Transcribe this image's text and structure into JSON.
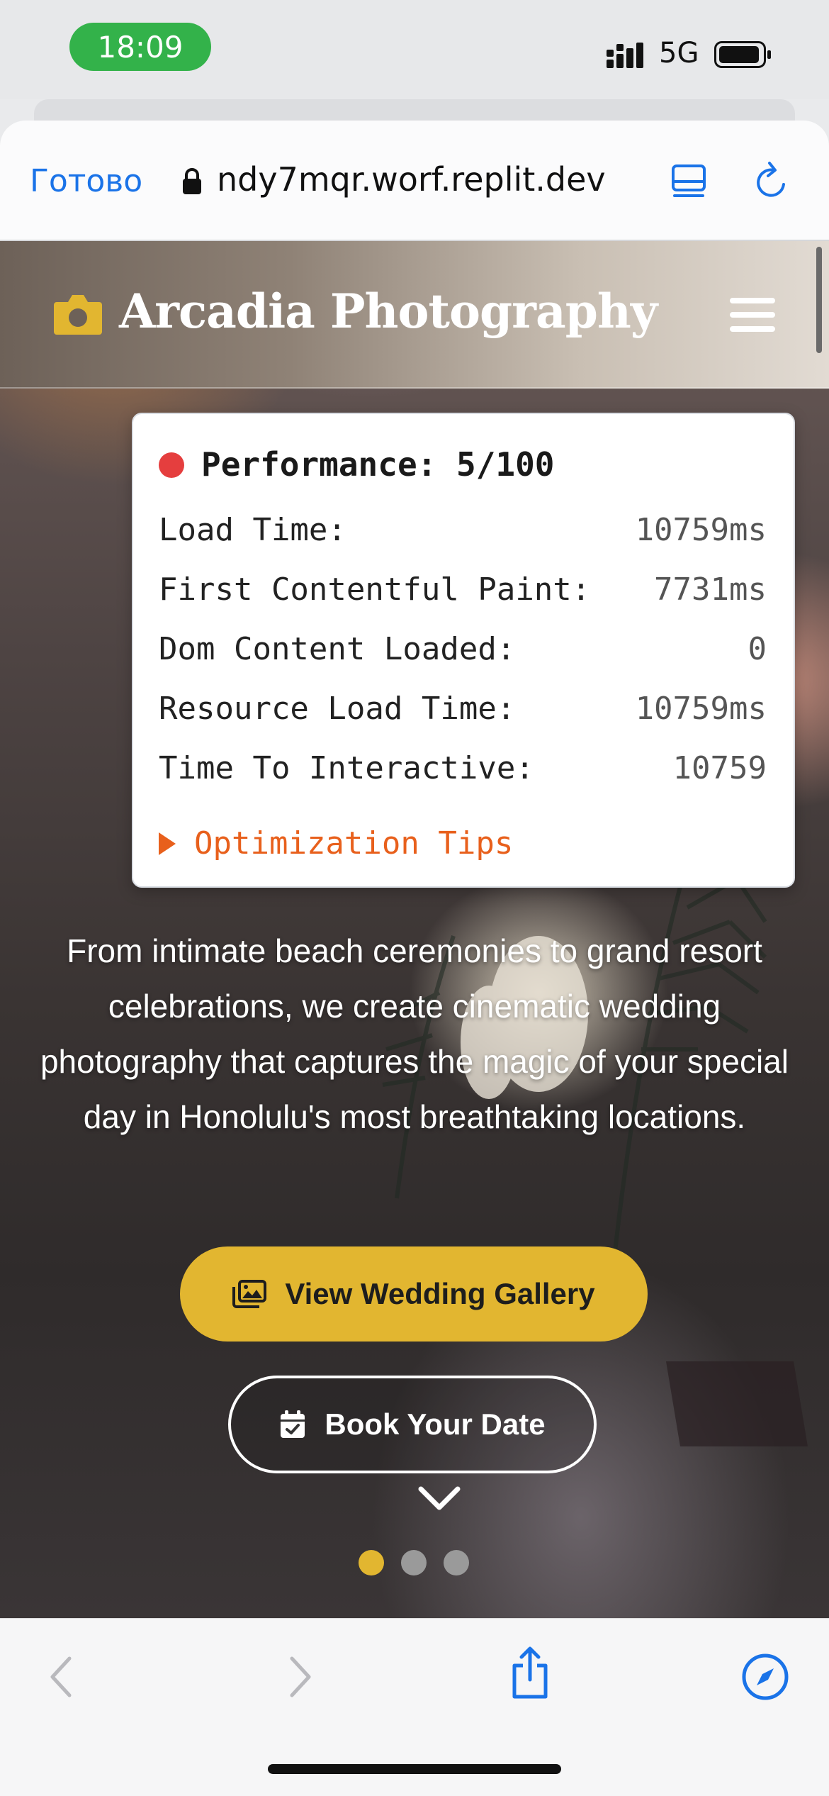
{
  "status_bar": {
    "time": "18:09",
    "network": "5G",
    "time_pill_color": "#33b24a"
  },
  "browser": {
    "done_label": "Готово",
    "url": "ndy7mqr.worf.replit.dev",
    "accent_color": "#1a73e8",
    "icons": [
      "lock-icon",
      "reader-mode-icon",
      "reload-icon",
      "back-icon",
      "forward-icon",
      "share-icon",
      "compass-icon"
    ]
  },
  "site": {
    "brand": "Arcadia Photography",
    "brand_icon": "camera-icon",
    "accent_color": "#e2b630",
    "performance": {
      "title": "Performance: 5/100",
      "status_color": "#e53e3e",
      "metrics": [
        {
          "label": "Load Time:",
          "value": "10759ms"
        },
        {
          "label": "First Contentful Paint:",
          "value": "7731ms"
        },
        {
          "label": "Dom Content Loaded:",
          "value": "0"
        },
        {
          "label": "Resource Load Time:",
          "value": "10759ms"
        },
        {
          "label": "Time To Interactive:",
          "value": "10759"
        }
      ],
      "tips_label": "Optimization Tips"
    },
    "hero_text": "From intimate beach ceremonies to grand resort celebrations, we create cinematic wedding photography that captures the magic of your special day in Honolulu's most breathtaking locations.",
    "gallery_button": "View Wedding Gallery",
    "book_button": "Book Your Date",
    "slides": {
      "count": 3,
      "active": 1
    }
  }
}
